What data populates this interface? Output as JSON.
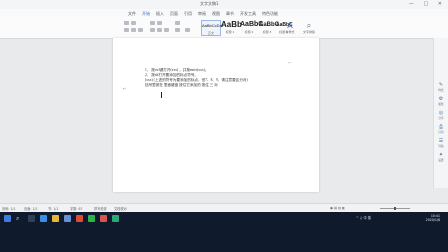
{
  "window": {
    "title": "文字文稿1",
    "controls": "— □ ✕"
  },
  "menu": {
    "items": [
      "文件",
      "开始",
      "插入",
      "页面",
      "引用",
      "审阅",
      "视图",
      "章节",
      "开发工具",
      "特色功能"
    ]
  },
  "ribbon": {
    "styles": [
      {
        "sample": "AaBbCcDd",
        "label": "正文"
      },
      {
        "sample": "AaBb",
        "label": "标题 1"
      },
      {
        "sample": "AaBbC",
        "label": "标题 2"
      },
      {
        "sample": "AaBbC",
        "label": "标题 3"
      },
      {
        "sample": "AaBbC",
        "label": "标题 4"
      }
    ],
    "new_style": {
      "icon": "A",
      "label": "新样式"
    },
    "find": {
      "icon": "⌕",
      "label": "文字排版"
    }
  },
  "document": {
    "lines": [
      "1、 按ctrl键打开(xxx) ，并按enter(xxx)。",
      "2、 按alt打开要添加的标点符号。",
      "   (xxx)  (上述的符号为要添加的标点，但7、8、9、请注意要区分对)",
      "   括号里按在 里面键盘 按住它添加的 按住 三 对"
    ]
  },
  "side_panel": {
    "items": [
      {
        "icon": "✎",
        "label": "样式"
      },
      {
        "icon": "⚙",
        "label": "属性"
      },
      {
        "icon": "◎",
        "label": "分享"
      },
      {
        "icon": "⎙",
        "label": "打印"
      },
      {
        "icon": "☰",
        "label": "导航"
      },
      {
        "icon": "✦",
        "label": "设置"
      }
    ]
  },
  "status": {
    "page": "页码: 1/1",
    "pages": "页面: 1/1",
    "section": "节: 1/1",
    "words": "字数: 67",
    "spell": "拼写检查",
    "doc_check": "文档校对"
  },
  "taskbar": {
    "search": "⌕",
    "tray_text": "^ ♫ 中 英",
    "time": "10:41",
    "date": "2020/1/8"
  }
}
